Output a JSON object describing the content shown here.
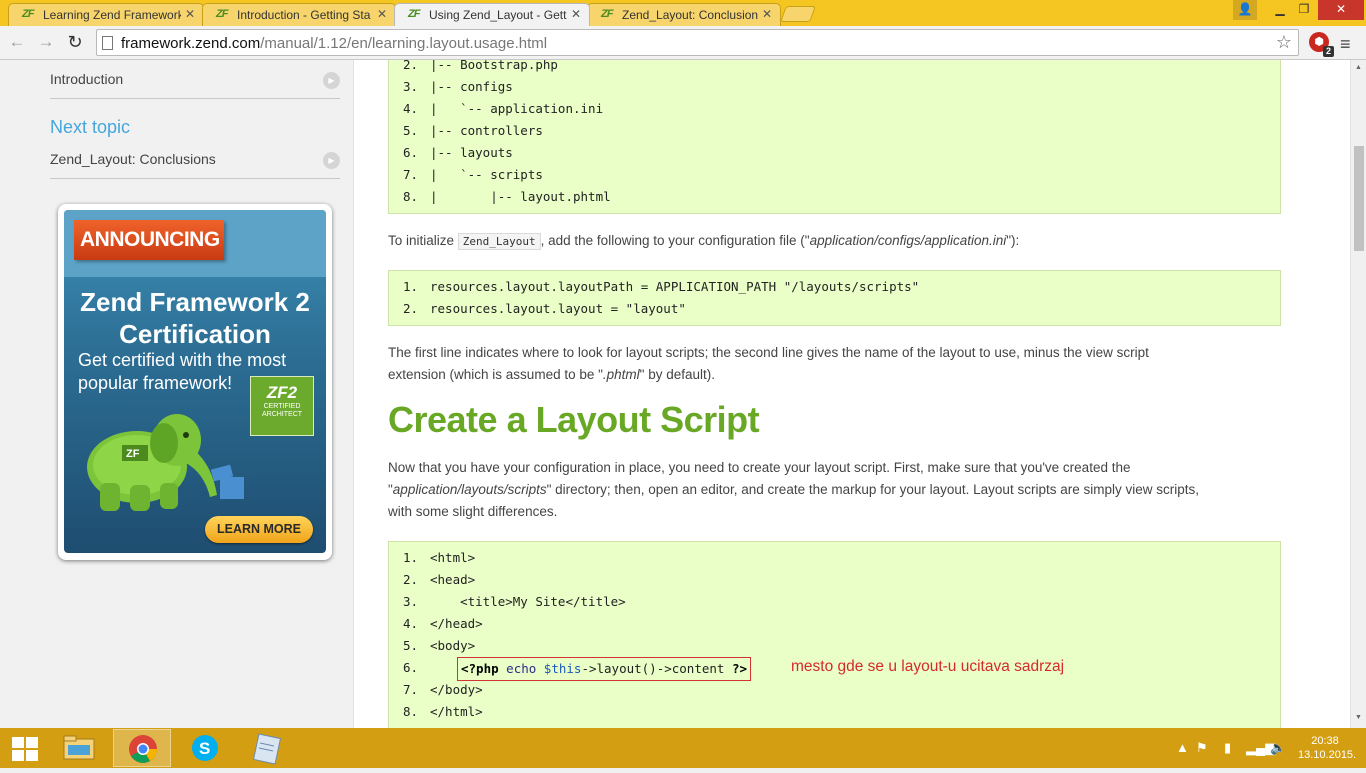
{
  "browser": {
    "tabs": [
      {
        "title": "Learning Zend Framework",
        "active": false
      },
      {
        "title": "Introduction - Getting Sta",
        "active": false
      },
      {
        "title": "Using Zend_Layout - Getti",
        "active": true
      },
      {
        "title": "Zend_Layout: Conclusions",
        "active": false
      }
    ],
    "url_host": "framework.zend.com",
    "url_path": "/manual/1.12/en/learning.layout.usage.html",
    "extension_badge": "2"
  },
  "sidebar": {
    "prev_link": "Introduction",
    "next_heading": "Next topic",
    "next_link": "Zend_Layout: Conclusions",
    "ad": {
      "banner": "ANNOUNCING",
      "title_line1": "Zend Framework 2",
      "title_line2": "Certification",
      "subtitle": "Get certified with the most popular framework!",
      "logo_mark": "ZF2",
      "logo_text": "CERTIFIED ARCHITECT",
      "cta": "LEARN MORE"
    }
  },
  "content": {
    "code_tree": [
      {
        "n": "2.",
        "t": "|-- Bootstrap.php"
      },
      {
        "n": "3.",
        "t": "|-- configs"
      },
      {
        "n": "4.",
        "t": "|   `-- application.ini"
      },
      {
        "n": "5.",
        "t": "|-- controllers"
      },
      {
        "n": "6.",
        "t": "|-- layouts"
      },
      {
        "n": "7.",
        "t": "|   `-- scripts"
      },
      {
        "n": "8.",
        "t": "|       |-- layout.phtml"
      }
    ],
    "para_init_before": "To initialize ",
    "para_init_code": "Zend_Layout",
    "para_init_mid": ", add the following to your configuration file (\"",
    "para_init_em": "application/configs/application.ini",
    "para_init_after": "\"):",
    "code_config": [
      {
        "n": "1.",
        "t": "resources.layout.layoutPath = APPLICATION_PATH \"/layouts/scripts\""
      },
      {
        "n": "2.",
        "t": "resources.layout.layout = \"layout\""
      }
    ],
    "para_first_line_a": "The first line indicates where to look for layout scripts; the second line gives the name of the layout to use, minus the view script",
    "para_first_line_b": "extension (which is assumed to be \"",
    "para_first_line_em": ".phtml",
    "para_first_line_c": "\" by default).",
    "heading": "Create a Layout Script",
    "para_now_a": "Now that you have your configuration in place, you need to create your layout script. First, make sure that you've created the",
    "para_now_b": "\"",
    "para_now_em": "application/layouts/scripts",
    "para_now_c": "\" directory; then, open an editor, and create the markup for your layout. Layout scripts are simply view scripts,",
    "para_now_d": "with some slight differences.",
    "code_layout": [
      {
        "n": "1.",
        "t": "<html>"
      },
      {
        "n": "2.",
        "t": "<head>"
      },
      {
        "n": "3.",
        "t": "    <title>My Site</title>"
      },
      {
        "n": "4.",
        "t": "</head>"
      },
      {
        "n": "5.",
        "t": "<body>"
      },
      {
        "n": "6.",
        "t": ""
      },
      {
        "n": "7.",
        "t": "</body>"
      },
      {
        "n": "8.",
        "t": "</html>"
      }
    ],
    "php_line": {
      "open": "<?php",
      "echo": " echo ",
      "var": "$this",
      "rest": "->layout()->content ",
      "close": "?>"
    },
    "annotation": "mesto gde se u layout-u ucitava sadrzaj"
  },
  "taskbar": {
    "time": "20:38",
    "date": "13.10.2015."
  },
  "colors": {
    "chrome_accent": "#f5c521",
    "code_bg": "#eaffc8",
    "heading_green": "#68a824",
    "link_blue": "#46a6dc",
    "annotation_red": "#d42a2a"
  }
}
